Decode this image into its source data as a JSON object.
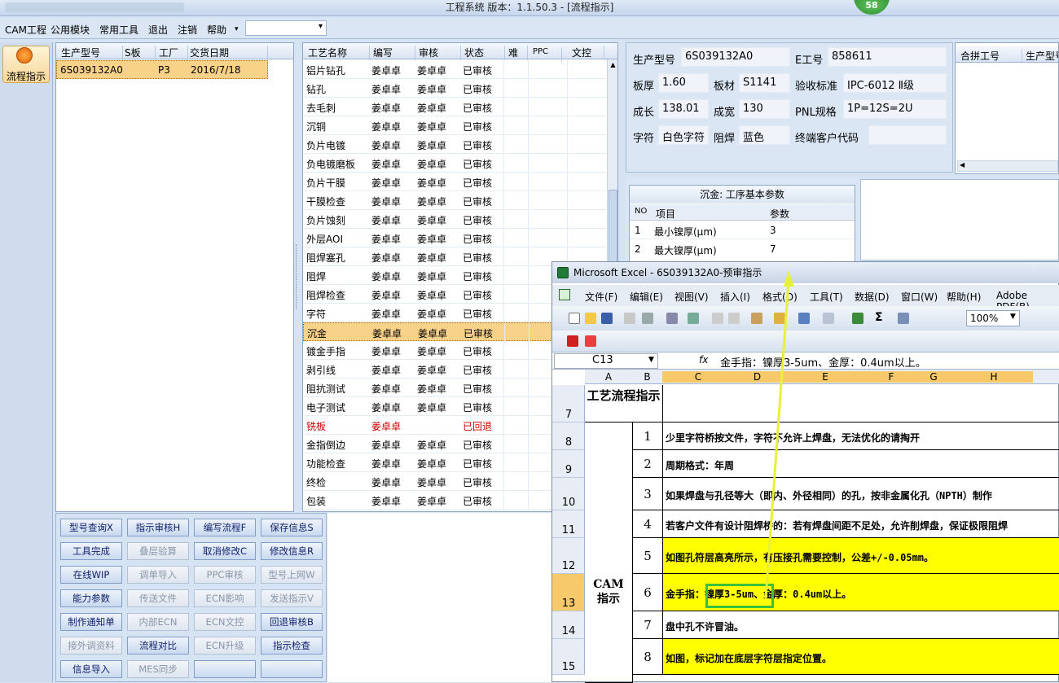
{
  "window": {
    "title": "工程系统  版本：1.1.50.3 - [流程指示]",
    "badge": "58"
  },
  "menu": [
    "CAM工程",
    "公用模块",
    "常用工具",
    "退出",
    "注销",
    "帮助"
  ],
  "sidebar": {
    "flow_label": "流程指示"
  },
  "grid1": {
    "headers": [
      "生产型号",
      "S板",
      "工厂",
      "交货日期"
    ],
    "rows": [
      [
        "6S039132A0",
        "",
        "P3",
        "2016/7/18"
      ]
    ]
  },
  "grid2": {
    "headers": [
      "工艺名称",
      "编写",
      "审核",
      "状态",
      "难",
      "PPC",
      "文控"
    ],
    "rows": [
      [
        "铝片钻孔",
        "姜卓卓",
        "姜卓卓",
        "已审核"
      ],
      [
        "钻孔",
        "姜卓卓",
        "姜卓卓",
        "已审核"
      ],
      [
        "去毛刺",
        "姜卓卓",
        "姜卓卓",
        "已审核"
      ],
      [
        "沉铜",
        "姜卓卓",
        "姜卓卓",
        "已审核"
      ],
      [
        "负片电镀",
        "姜卓卓",
        "姜卓卓",
        "已审核"
      ],
      [
        "负电镀磨板",
        "姜卓卓",
        "姜卓卓",
        "已审核"
      ],
      [
        "负片干膜",
        "姜卓卓",
        "姜卓卓",
        "已审核"
      ],
      [
        "干膜检查",
        "姜卓卓",
        "姜卓卓",
        "已审核"
      ],
      [
        "负片蚀刻",
        "姜卓卓",
        "姜卓卓",
        "已审核"
      ],
      [
        "外层AOI",
        "姜卓卓",
        "姜卓卓",
        "已审核"
      ],
      [
        "阻焊塞孔",
        "姜卓卓",
        "姜卓卓",
        "已审核"
      ],
      [
        "阻焊",
        "姜卓卓",
        "姜卓卓",
        "已审核"
      ],
      [
        "阻焊检查",
        "姜卓卓",
        "姜卓卓",
        "已审核"
      ],
      [
        "字符",
        "姜卓卓",
        "姜卓卓",
        "已审核"
      ],
      [
        "沉金",
        "姜卓卓",
        "姜卓卓",
        "已审核"
      ],
      [
        "镀金手指",
        "姜卓卓",
        "姜卓卓",
        "已审核"
      ],
      [
        "剥引线",
        "姜卓卓",
        "姜卓卓",
        "已审核"
      ],
      [
        "阻抗测试",
        "姜卓卓",
        "姜卓卓",
        "已审核"
      ],
      [
        "电子测试",
        "姜卓卓",
        "姜卓卓",
        "已审核"
      ],
      [
        "铣板",
        "姜卓卓",
        "",
        "已回退"
      ],
      [
        "金指倒边",
        "姜卓卓",
        "姜卓卓",
        "已审核"
      ],
      [
        "功能检查",
        "姜卓卓",
        "姜卓卓",
        "已审核"
      ],
      [
        "终检",
        "姜卓卓",
        "姜卓卓",
        "已审核"
      ],
      [
        "包装",
        "姜卓卓",
        "姜卓卓",
        "已审核"
      ]
    ],
    "selected_index": 14,
    "rejected_index": 19
  },
  "info": {
    "model_label": "生产型号",
    "model": "6S039132A0",
    "eno_label": "E工号",
    "eno": "858611",
    "thick_label": "板厚",
    "thick": "1.60",
    "mat_label": "板材",
    "mat": "S1141",
    "std_label": "验收标准",
    "std": "IPC-6012 Ⅱ级",
    "len_label": "成长",
    "len": "138.01",
    "wid_label": "成宽",
    "wid": "130",
    "pnl_label": "PNL规格",
    "pnl": "1P=12S=2U",
    "char_label": "字符",
    "char": "白色字符",
    "mask_label": "阻焊",
    "mask": "蓝色",
    "cust_label": "终端客户代码",
    "cust": ""
  },
  "grid3": {
    "headers": [
      "合拼工号",
      "生产型号"
    ]
  },
  "params": {
    "title": "沉金: 工序基本参数",
    "headers": [
      "NO",
      "项目",
      "参数"
    ],
    "rows": [
      [
        "1",
        "最小镍厚(μm)",
        "3"
      ],
      [
        "2",
        "最大镍厚(μm)",
        "7"
      ]
    ]
  },
  "buttons": [
    [
      "型号查询X",
      "指示审核H",
      "编写流程F",
      "保存信息S"
    ],
    [
      "工具完成",
      "叠层验算",
      "取消修改C",
      "修改信息R"
    ],
    [
      "在线WIP",
      "调单导入",
      "PPC审核",
      "型号上网W"
    ],
    [
      "能力参数",
      "传送文件",
      "ECN影响",
      "发送指示V"
    ],
    [
      "制作通知单",
      "内部ECN",
      "ECN文控",
      "回退审核B"
    ],
    [
      "接外调资料",
      "流程对比",
      "ECN升级",
      "指示检查"
    ],
    [
      "信息导入",
      "MES同步",
      "",
      ""
    ]
  ],
  "buttons_disabled": [
    [
      1,
      1
    ],
    [
      2,
      1
    ],
    [
      2,
      2
    ],
    [
      2,
      3
    ],
    [
      3,
      1
    ],
    [
      3,
      2
    ],
    [
      3,
      3
    ],
    [
      4,
      1
    ],
    [
      4,
      2
    ],
    [
      5,
      0
    ],
    [
      5,
      2
    ],
    [
      6,
      1
    ]
  ],
  "excel": {
    "title": "Microsoft Excel - 6S039132A0-预审指示",
    "menu": [
      "文件(F)",
      "编辑(E)",
      "视图(V)",
      "插入(I)",
      "格式(O)",
      "工具(T)",
      "数据(D)",
      "窗口(W)",
      "帮助(H)",
      "Adobe PDF(B)"
    ],
    "zoom": "100%",
    "namebox": "C13",
    "fx": "fx",
    "formula": "金手指：镍厚3-5um、金厚：0.4um以上。",
    "columns": [
      "A",
      "B",
      "C",
      "D",
      "E",
      "F",
      "G",
      "H"
    ],
    "section1": "工艺流程指示",
    "section2": "CAM指示",
    "rows": [
      {
        "rn": "7",
        "num": "",
        "text": ""
      },
      {
        "rn": "8",
        "num": "1",
        "text": "少里字符桥按文件，字符不允许上焊盘，无法优化的请掏开"
      },
      {
        "rn": "9",
        "num": "2",
        "text": "周期格式：年周"
      },
      {
        "rn": "10",
        "num": "3",
        "text": "如果焊盘与孔径等大（即内、外径相同）的孔，按非金属化孔（NPTH）制作"
      },
      {
        "rn": "11",
        "num": "4",
        "text": "若客户文件有设计阻焊桥的：若有焊盘间距不足处，允许削焊盘，保证极限阻焊"
      },
      {
        "rn": "12",
        "num": "5",
        "text": "如图孔符层高亮所示，有压接孔需要控制，公差+/-0.05mm。"
      },
      {
        "rn": "13",
        "num": "6",
        "text": "金手指：镍厚3-5um、金厚：0.4um以上。"
      },
      {
        "rn": "14",
        "num": "7",
        "text": "盘中孔不许冒油。"
      },
      {
        "rn": "15",
        "num": "8",
        "text": "如图，标记加在底层字符层指定位置。"
      }
    ]
  },
  "colors": {
    "accent_yellow": "#ffff00",
    "selected_row": "#f9d28a",
    "rejected": "#d00000",
    "arrow": "#e8f03a"
  }
}
